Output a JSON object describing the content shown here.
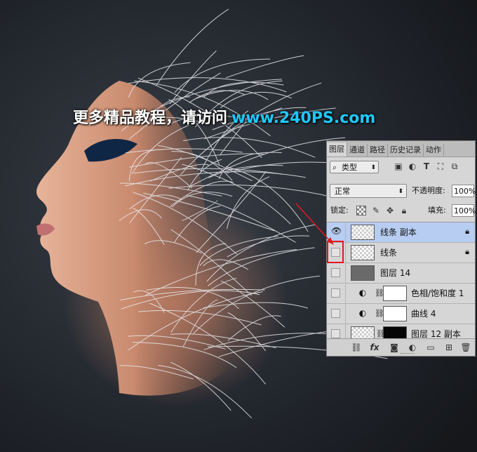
{
  "watermark": {
    "text_cn": "更多精品教程，请访问",
    "url": "www.240PS.com"
  },
  "layers_panel": {
    "tabs": [
      "图层",
      "通道",
      "路径",
      "历史记录",
      "动作"
    ],
    "filter": {
      "kind_label": "类型",
      "search_glyph": "⌕"
    },
    "blend_mode": "正常",
    "opacity_label": "不透明度:",
    "opacity_value": "100%",
    "lock_label": "锁定:",
    "fill_label": "填充:",
    "fill_value": "100%",
    "layers": [
      {
        "name": "线条 副本",
        "visible": true,
        "selected": true,
        "thumb": "transparent",
        "locked": true
      },
      {
        "name": "线条",
        "visible": false,
        "selected": false,
        "thumb": "transparent",
        "locked": true
      },
      {
        "name": "图层 14",
        "visible": false,
        "selected": false,
        "thumb": "dark",
        "locked": false
      },
      {
        "name": "色相/饱和度 1",
        "visible": false,
        "selected": false,
        "thumb": "white",
        "adjustment": "hue-saturation-icon"
      },
      {
        "name": "曲线 4",
        "visible": false,
        "selected": false,
        "thumb": "white",
        "adjustment": "curves-icon"
      },
      {
        "name": "图层 12 副本",
        "visible": false,
        "selected": false,
        "thumb": "transparent",
        "mask": "black"
      }
    ],
    "bottom_icons": [
      "link-icon",
      "fx-icon",
      "mask-icon",
      "adjustment-icon",
      "folder-icon",
      "new-layer-icon",
      "trash-icon"
    ],
    "fx_label": "fx"
  },
  "colors": {
    "background": "#1c1f25",
    "watermark_url": "#1ec8ff",
    "selection": "#b7cdf1",
    "annotation": "#e0191e"
  }
}
